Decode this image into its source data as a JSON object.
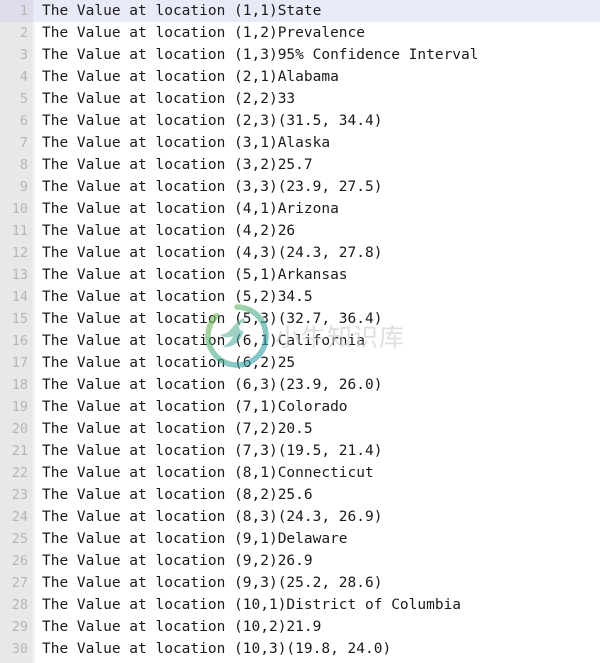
{
  "editor": {
    "type": "code-editor-output-pane",
    "total_lines": 30,
    "current_line": 1,
    "colors": {
      "background": "#ffffff",
      "gutter_background": "#e8e8e8",
      "gutter_text": "#b5b5b5",
      "text": "#1a1a1a",
      "current_line_highlight": "#e9eaf7"
    },
    "lines": [
      {
        "n": "1",
        "text": "The Value at location (1,1)State"
      },
      {
        "n": "2",
        "text": "The Value at location (1,2)Prevalence"
      },
      {
        "n": "3",
        "text": "The Value at location (1,3)95% Confidence Interval"
      },
      {
        "n": "4",
        "text": "The Value at location (2,1)Alabama"
      },
      {
        "n": "5",
        "text": "The Value at location (2,2)33"
      },
      {
        "n": "6",
        "text": "The Value at location (2,3)(31.5, 34.4)"
      },
      {
        "n": "7",
        "text": "The Value at location (3,1)Alaska"
      },
      {
        "n": "8",
        "text": "The Value at location (3,2)25.7"
      },
      {
        "n": "9",
        "text": "The Value at location (3,3)(23.9, 27.5)"
      },
      {
        "n": "10",
        "text": "The Value at location (4,1)Arizona"
      },
      {
        "n": "11",
        "text": "The Value at location (4,2)26"
      },
      {
        "n": "12",
        "text": "The Value at location (4,3)(24.3, 27.8)"
      },
      {
        "n": "13",
        "text": "The Value at location (5,1)Arkansas"
      },
      {
        "n": "14",
        "text": "The Value at location (5,2)34.5"
      },
      {
        "n": "15",
        "text": "The Value at location (5,3)(32.7, 36.4)"
      },
      {
        "n": "16",
        "text": "The Value at location (6,1)California"
      },
      {
        "n": "17",
        "text": "The Value at location (6,2)25"
      },
      {
        "n": "18",
        "text": "The Value at location (6,3)(23.9, 26.0)"
      },
      {
        "n": "19",
        "text": "The Value at location (7,1)Colorado"
      },
      {
        "n": "20",
        "text": "The Value at location (7,2)20.5"
      },
      {
        "n": "21",
        "text": "The Value at location (7,3)(19.5, 21.4)"
      },
      {
        "n": "22",
        "text": "The Value at location (8,1)Connecticut"
      },
      {
        "n": "23",
        "text": "The Value at location (8,2)25.6"
      },
      {
        "n": "24",
        "text": "The Value at location (8,3)(24.3, 26.9)"
      },
      {
        "n": "25",
        "text": "The Value at location (9,1)Delaware"
      },
      {
        "n": "26",
        "text": "The Value at location (9,2)26.9"
      },
      {
        "n": "27",
        "text": "The Value at location (9,3)(25.2, 28.6)"
      },
      {
        "n": "28",
        "text": "The Value at location (10,1)District of Columbia"
      },
      {
        "n": "29",
        "text": "The Value at location (10,2)21.9"
      },
      {
        "n": "30",
        "text": "The Value at location (10,3)(19.8, 24.0)"
      }
    ]
  },
  "watermark": {
    "text": "小牛知识库",
    "logo_icon": "circular-ring-figure-logo-icon",
    "colors": {
      "ring_start": "#7fb94f",
      "ring_end": "#2f9fb5",
      "text": "#c9cdd0"
    }
  }
}
